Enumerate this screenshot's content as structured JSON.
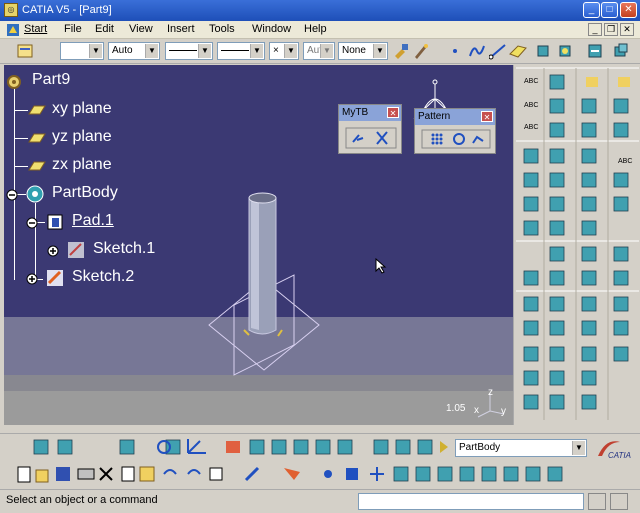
{
  "window": {
    "title": "CATIA V5 - [Part9]",
    "minimize": "_",
    "maximize": "□",
    "close": "✕"
  },
  "menu": {
    "items": [
      "Start",
      "File",
      "Edit",
      "View",
      "Insert",
      "Tools",
      "Window",
      "Help"
    ]
  },
  "toolbar_top": {
    "color_value": "",
    "transparency_value": "Auto",
    "layer_value": "Aut",
    "layer2_value": "None"
  },
  "tree": {
    "root": "Part9",
    "items": [
      "xy plane",
      "yz plane",
      "zx plane",
      "PartBody",
      "Pad.1",
      "Sketch.1",
      "Sketch.2"
    ]
  },
  "floating_toolbars": {
    "mytb": "MyTB",
    "pattern": "Pattern"
  },
  "viewport": {
    "scale": "1.05",
    "axis_z": "z",
    "axis_x": "x",
    "axis_y": "y"
  },
  "bottom_toolbar": {
    "body_select": "PartBody"
  },
  "status": {
    "text": "Select an object or a command",
    "input_value": ""
  },
  "colors": {
    "viewport_bg": "#3b3973",
    "titlebar": "#2a5fd0"
  }
}
